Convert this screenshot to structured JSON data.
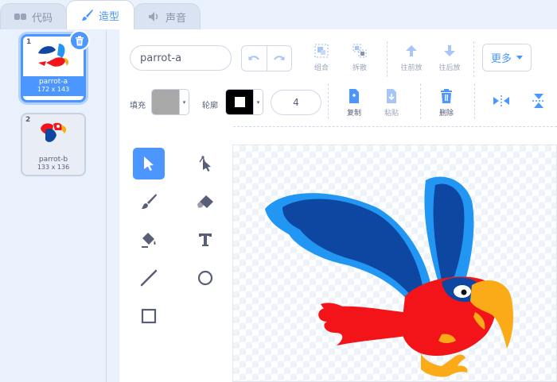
{
  "tabs": [
    {
      "label": "代码",
      "icon": "code-icon",
      "active": false
    },
    {
      "label": "造型",
      "icon": "paintbrush-icon",
      "active": true
    },
    {
      "label": "声音",
      "icon": "speaker-icon",
      "active": false
    }
  ],
  "costumes": [
    {
      "number": "1",
      "name": "parrot-a",
      "size": "172 x 143",
      "selected": true
    },
    {
      "number": "2",
      "name": "parrot-b",
      "size": "133 x 136",
      "selected": false
    }
  ],
  "editor": {
    "costume_name": "parrot-a",
    "group_label": "组合",
    "ungroup_label": "拆散",
    "forward_label": "往前放",
    "backward_label": "往后放",
    "more_label": "更多",
    "fill_label": "填充",
    "outline_label": "轮廓",
    "outline_width": "4",
    "copy_label": "复制",
    "paste_label": "粘贴",
    "delete_label": "删除",
    "fill_color": "#a8a8a8",
    "outline_color": "#000000"
  },
  "colors": {
    "accent": "#4c97ff",
    "text": "#575e75",
    "parrot_blue": "#0d47a1",
    "parrot_light_blue": "#2196f3",
    "parrot_red": "#f3141a",
    "parrot_orange": "#fbab18"
  }
}
